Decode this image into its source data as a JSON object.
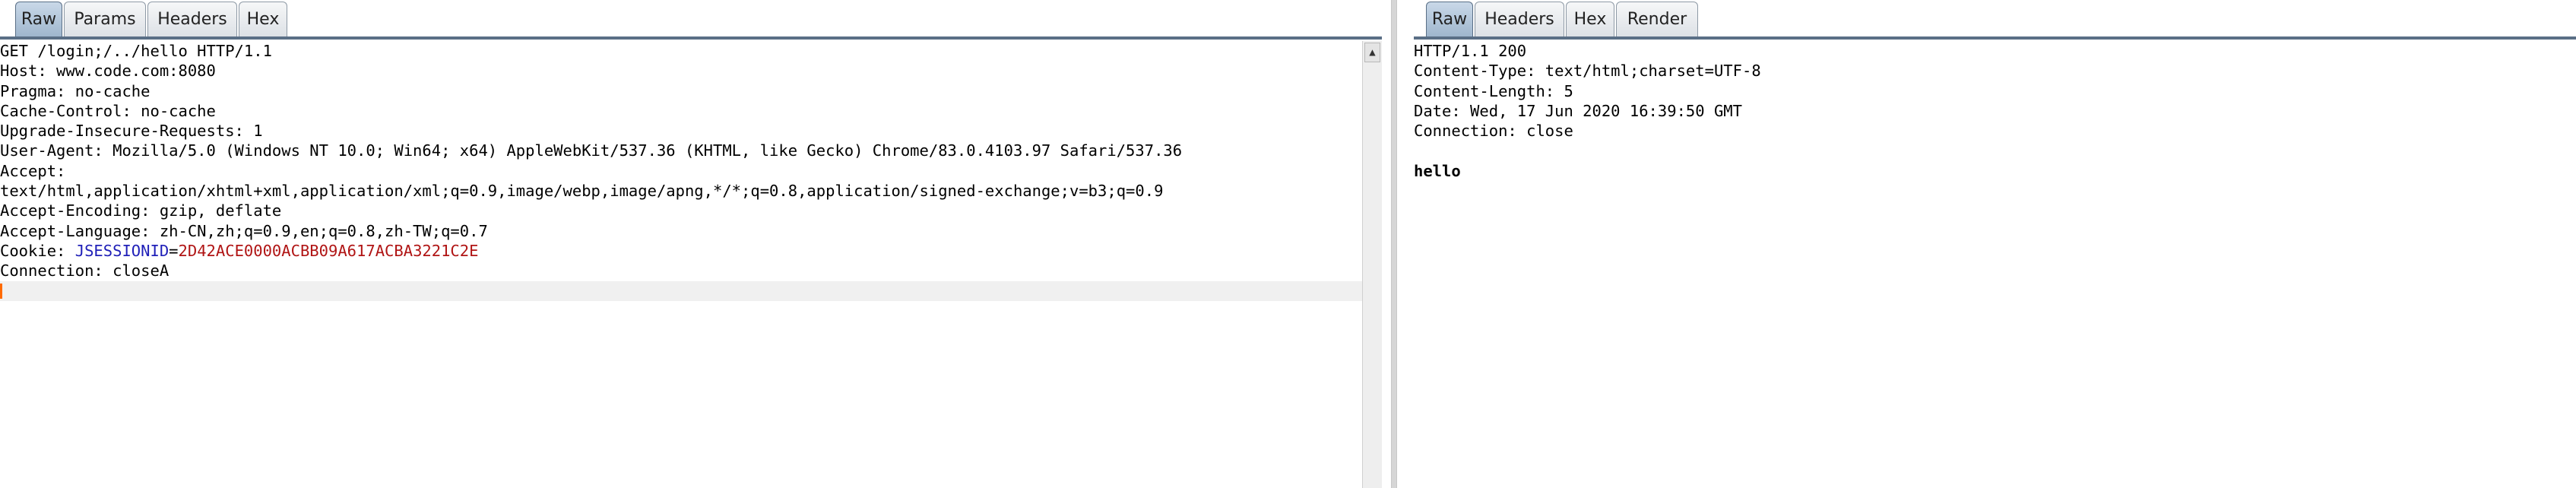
{
  "request": {
    "tabs": [
      "Raw",
      "Params",
      "Headers",
      "Hex"
    ],
    "active_tab": "Raw",
    "lines": [
      "GET /login;/../hello HTTP/1.1",
      "Host: www.code.com:8080",
      "Pragma: no-cache",
      "Cache-Control: no-cache",
      "Upgrade-Insecure-Requests: 1",
      "User-Agent: Mozilla/5.0 (Windows NT 10.0; Win64; x64) AppleWebKit/537.36 (KHTML, like Gecko) Chrome/83.0.4103.97 Safari/537.36",
      "Accept:",
      "text/html,application/xhtml+xml,application/xml;q=0.9,image/webp,image/apng,*/*;q=0.8,application/signed-exchange;v=b3;q=0.9",
      "Accept-Encoding: gzip, deflate",
      "Accept-Language: zh-CN,zh;q=0.9,en;q=0.8,zh-TW;q=0.7"
    ],
    "cookie": {
      "label": "Cookie: ",
      "name": "JSESSIONID",
      "eq": "=",
      "value": "2D42ACE0000ACBB09A617ACBA3221C2E"
    },
    "last_line": "Connection: closeA"
  },
  "response": {
    "tabs": [
      "Raw",
      "Headers",
      "Hex",
      "Render"
    ],
    "active_tab": "Raw",
    "lines": [
      "HTTP/1.1 200",
      "Content-Type: text/html;charset=UTF-8",
      "Content-Length: 5",
      "Date: Wed, 17 Jun 2020 16:39:50 GMT",
      "Connection: close"
    ],
    "body": "hello"
  },
  "icons": {
    "scroll_up": "arrow-up-icon",
    "scroll_up_glyph": "▲"
  }
}
